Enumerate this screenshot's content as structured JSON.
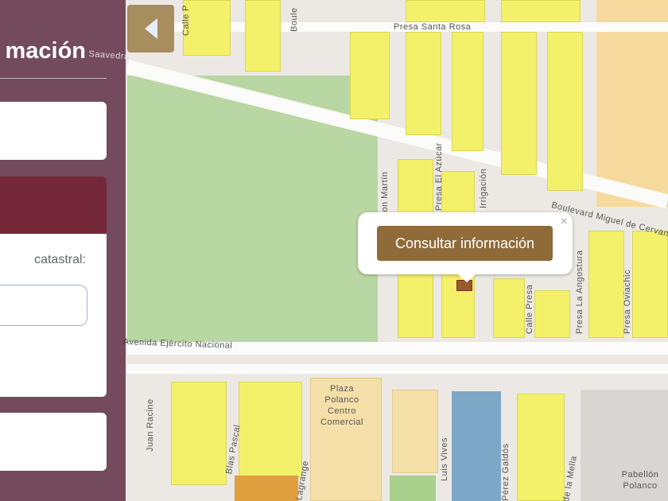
{
  "panel": {
    "title": "mación",
    "field_label": "catastral:",
    "field_value": ""
  },
  "toggle_icon": "chevron-left-icon",
  "popup": {
    "button_label": "Consultar información",
    "close_label": "×"
  },
  "map": {
    "streets": [
      "Presa Santa Rosa",
      "Saavedra",
      "Calle P",
      "Boule",
      "Don Martín",
      "Presa El Azúcar",
      "Irrigación",
      "Boulevard Miguel de Cervantes",
      "Presa La Angostura",
      "Presa Oviachic",
      "Calle Presa",
      "Avenida Ejército Nacional",
      "Juan Racine",
      "Blas Pascal",
      "Lagrange",
      "Luis Vives",
      "Pérez Galdós",
      "de la Mella"
    ],
    "places": [
      "Plaza Polanco Centro Comercial",
      "Pabellón Polanco"
    ]
  }
}
